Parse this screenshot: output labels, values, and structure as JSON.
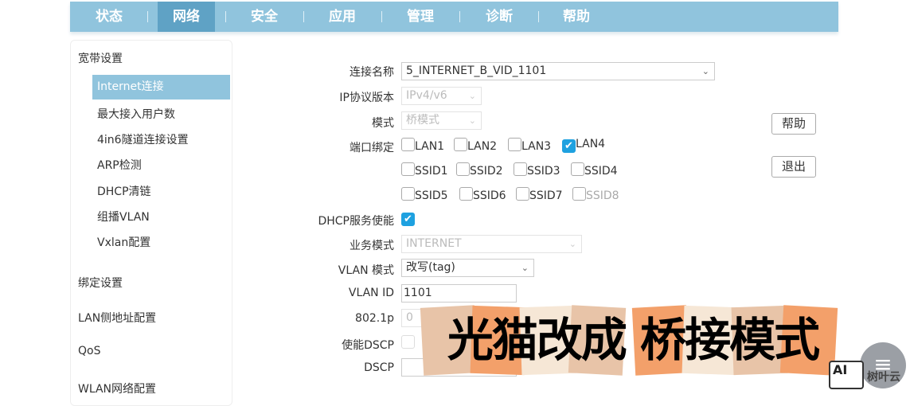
{
  "nav": {
    "tabs": [
      "状态",
      "网络",
      "安全",
      "应用",
      "管理",
      "诊断",
      "帮助"
    ],
    "active": "网络"
  },
  "sidebar": {
    "group1": "宽带设置",
    "sub": [
      "Internet连接",
      "最大接入用户数",
      "4in6隧道连接设置",
      "ARP检测",
      "DHCP清链",
      "组播VLAN",
      "Vxlan配置"
    ],
    "groups": [
      "绑定设置",
      "LAN侧地址配置",
      "QoS",
      "WLAN网络配置"
    ]
  },
  "form": {
    "conn_name_label": "连接名称",
    "conn_name": "5_INTERNET_B_VID_1101",
    "ip_label": "IP协议版本",
    "ip": "IPv4/v6",
    "mode_label": "模式",
    "mode": "桥模式",
    "port_label": "端口绑定",
    "ports": [
      {
        "label": "LAN1",
        "checked": false
      },
      {
        "label": "LAN2",
        "checked": false
      },
      {
        "label": "LAN3",
        "checked": false
      },
      {
        "label": "LAN4",
        "checked": true
      },
      {
        "label": "SSID1",
        "checked": false
      },
      {
        "label": "SSID2",
        "checked": false
      },
      {
        "label": "SSID3",
        "checked": false
      },
      {
        "label": "SSID4",
        "checked": false
      },
      {
        "label": "SSID5",
        "checked": false
      },
      {
        "label": "SSID6",
        "checked": false
      },
      {
        "label": "SSID7",
        "checked": false
      },
      {
        "label": "SSID8",
        "checked": false
      }
    ],
    "dhcp_label": "DHCP服务使能",
    "dhcp_checked": true,
    "service_label": "业务模式",
    "service": "INTERNET",
    "vlan_mode_label": "VLAN 模式",
    "vlan_mode": "改写(tag)",
    "vlan_id_label": "VLAN ID",
    "vlan_id": "1101",
    "p8021_label": "802.1p",
    "p8021": "0",
    "dscp_en_label": "使能DSCP",
    "dscp_label": "DSCP",
    "dscp": ""
  },
  "buttons": {
    "help": "帮助",
    "exit": "退出"
  },
  "overlay": {
    "caption": "光猫改成 桥接模式",
    "watermark_logo": "AI",
    "watermark_text": "树叶云",
    "menu_icon": "≡"
  },
  "colors": {
    "nav": "#90c4dd",
    "nav_active": "#5fa2c5",
    "check": "#1ea1e0"
  }
}
